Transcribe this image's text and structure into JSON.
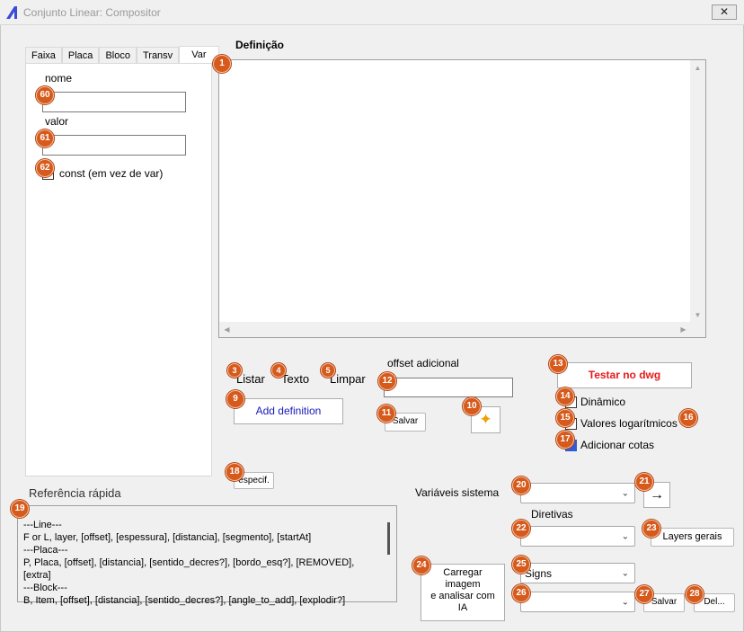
{
  "window": {
    "title": "Conjunto Linear: Compositor",
    "close_glyph": "✕"
  },
  "tabs": [
    "Faixa",
    "Placa",
    "Bloco",
    "Transv",
    "Var"
  ],
  "var_panel": {
    "nome_label": "nome",
    "nome_value": "",
    "valor_label": "valor",
    "valor_value": "",
    "const_label": "const (em vez de var)"
  },
  "definition": {
    "label": "Definição",
    "value": ""
  },
  "actions": {
    "listar": "Listar",
    "texto": "Texto",
    "limpar": "Limpar",
    "add_definition": "Add definition",
    "offset_label": "offset adicional",
    "offset_value": "",
    "salvar": "Salvar",
    "ai_icon": "✦"
  },
  "test": {
    "testar": "Testar no dwg",
    "dinamico": "Dinâmico",
    "valores_log": "Valores logarítmicos",
    "adicionar_cotas": "Adicionar cotas"
  },
  "especif": "especif.",
  "quick_ref": {
    "title": "Referência rápida",
    "lines": [
      "---Line---",
      "F or L, layer, [offset], [espessura], [distancia], [segmento], [startAt]",
      "---Placa---",
      "P, Placa, [offset], [distancia], [sentido_decres?], [bordo_esq?], [REMOVED],",
      "[extra]",
      "---Block---",
      "B, Item, [offset], [distancia], [sentido_decres?], [angle_to_add], [explodir?]"
    ]
  },
  "system": {
    "variaveis_label": "Variáveis sistema",
    "variaveis_value": "",
    "arrow_button": "→",
    "diretivas_label": "Diretivas",
    "diretivas_value": "",
    "layers_gerais": "Layers gerais",
    "carregar": [
      "Carregar",
      "imagem",
      "e analisar com",
      "IA"
    ],
    "signs_value": "Signs",
    "item_value": "",
    "salvar": "Salvar",
    "del": "Del..."
  },
  "badges": [
    "1",
    "3",
    "4",
    "5",
    "9",
    "10",
    "11",
    "12",
    "13",
    "14",
    "15",
    "16",
    "17",
    "18",
    "19",
    "20",
    "21",
    "22",
    "23",
    "24",
    "25",
    "26",
    "27",
    "28",
    "60",
    "61",
    "62"
  ],
  "colors": {
    "badge": "#d65a1c",
    "testar_text": "#e81a1a",
    "add_def_text": "#1a1ab8",
    "star": "#f0a000"
  }
}
